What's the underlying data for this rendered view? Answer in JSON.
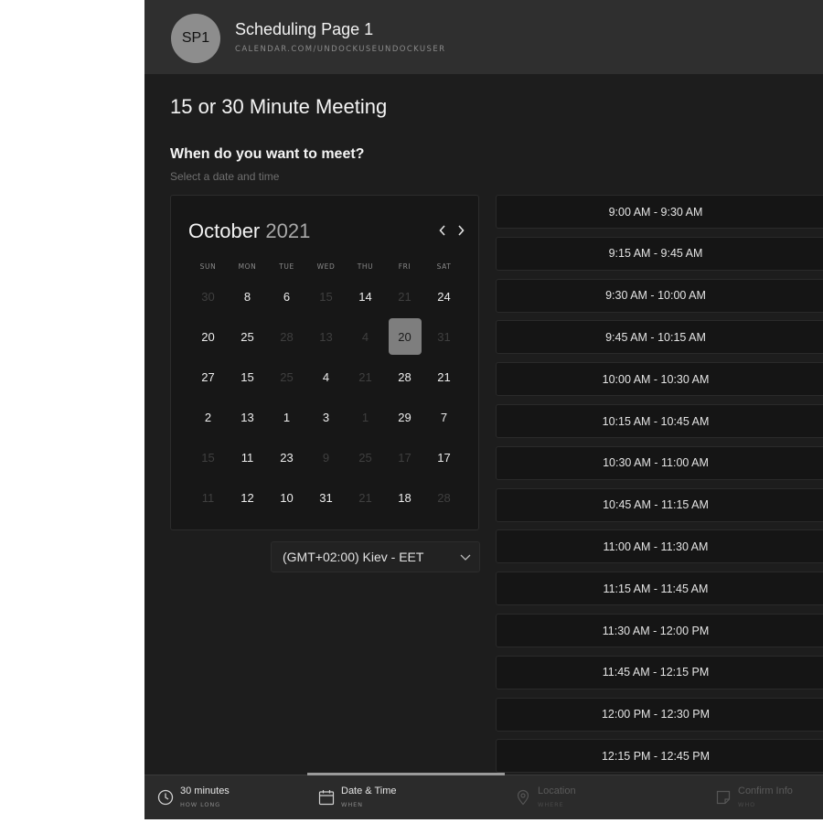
{
  "header": {
    "avatar_initials": "SP1",
    "page_name": "Scheduling Page 1",
    "page_url": "CALENDAR.COM/UNDOCKUSEUNDOCKUSER"
  },
  "meeting": {
    "title": "15 or 30 Minute Meeting",
    "question": "When do you want to meet?",
    "hint": "Select a date and time"
  },
  "calendar": {
    "month": "October",
    "year": "2021",
    "weekdays": [
      "SUN",
      "MON",
      "TUE",
      "WED",
      "THU",
      "FRI",
      "SAT"
    ],
    "weeks": [
      [
        {
          "d": "30",
          "on": false
        },
        {
          "d": "8",
          "on": true
        },
        {
          "d": "6",
          "on": true
        },
        {
          "d": "15",
          "on": false
        },
        {
          "d": "14",
          "on": true
        },
        {
          "d": "21",
          "on": false
        },
        {
          "d": "24",
          "on": true
        }
      ],
      [
        {
          "d": "20",
          "on": true
        },
        {
          "d": "25",
          "on": true
        },
        {
          "d": "28",
          "on": false
        },
        {
          "d": "13",
          "on": false
        },
        {
          "d": "4",
          "on": false
        },
        {
          "d": "20",
          "on": true,
          "selected": true
        },
        {
          "d": "31",
          "on": false
        }
      ],
      [
        {
          "d": "27",
          "on": true
        },
        {
          "d": "15",
          "on": true
        },
        {
          "d": "25",
          "on": false
        },
        {
          "d": "4",
          "on": true
        },
        {
          "d": "21",
          "on": false
        },
        {
          "d": "28",
          "on": true
        },
        {
          "d": "21",
          "on": true
        }
      ],
      [
        {
          "d": "2",
          "on": true
        },
        {
          "d": "13",
          "on": true
        },
        {
          "d": "1",
          "on": true
        },
        {
          "d": "3",
          "on": true
        },
        {
          "d": "1",
          "on": false
        },
        {
          "d": "29",
          "on": true
        },
        {
          "d": "7",
          "on": true
        }
      ],
      [
        {
          "d": "15",
          "on": false
        },
        {
          "d": "11",
          "on": true
        },
        {
          "d": "23",
          "on": true
        },
        {
          "d": "9",
          "on": false
        },
        {
          "d": "25",
          "on": false
        },
        {
          "d": "17",
          "on": false
        },
        {
          "d": "17",
          "on": true
        }
      ],
      [
        {
          "d": "11",
          "on": false
        },
        {
          "d": "12",
          "on": true
        },
        {
          "d": "10",
          "on": true
        },
        {
          "d": "31",
          "on": true
        },
        {
          "d": "21",
          "on": false
        },
        {
          "d": "18",
          "on": true
        },
        {
          "d": "28",
          "on": false
        }
      ]
    ]
  },
  "timezone": {
    "value": "(GMT+02:00) Kiev - EET"
  },
  "slots": [
    "9:00 AM - 9:30 AM",
    "9:15 AM - 9:45 AM",
    "9:30 AM - 10:00 AM",
    "9:45 AM - 10:15 AM",
    "10:00 AM - 10:30 AM",
    "10:15 AM - 10:45 AM",
    "10:30 AM - 11:00 AM",
    "10:45 AM - 11:15 AM",
    "11:00 AM - 11:30 AM",
    "11:15 AM - 11:45 AM",
    "11:30 AM - 12:00 PM",
    "11:45 AM - 12:15 PM",
    "12:00 PM - 12:30 PM",
    "12:15 PM - 12:45 PM"
  ],
  "steps": [
    {
      "title": "30 minutes",
      "sub": "HOW LONG",
      "icon": "clock-icon",
      "active": true
    },
    {
      "title": "Date & Time",
      "sub": "WHEN",
      "icon": "calendar-icon",
      "active": true
    },
    {
      "title": "Location",
      "sub": "WHERE",
      "icon": "location-pin-icon",
      "active": false
    },
    {
      "title": "Confirm Info",
      "sub": "WHO",
      "icon": "note-icon",
      "active": false
    }
  ],
  "colors": {
    "background": "#1d1d1d",
    "header": "#2f2f2f",
    "selected_day": "#7e7e7e"
  }
}
